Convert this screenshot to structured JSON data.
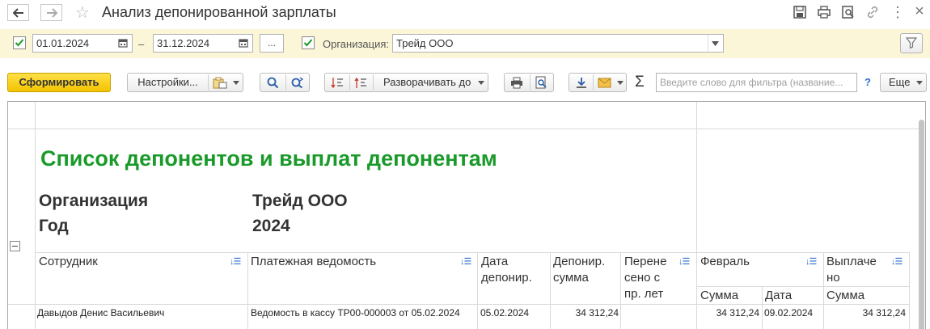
{
  "window": {
    "title": "Анализ депонированной зарплаты",
    "back_icon": "arrow-left-icon",
    "forward_icon": "arrow-right-icon",
    "favorite_icon": "star-icon",
    "title_icons": [
      "save-icon",
      "print-icon",
      "preview-icon",
      "link-icon",
      "more-icon",
      "close-icon"
    ],
    "more_glyph": "⋮",
    "close_glyph": "×"
  },
  "filter": {
    "period_checked": true,
    "date_from": "01.01.2024",
    "date_separator": "–",
    "date_to": "31.12.2024",
    "period_more_label": "...",
    "org_checked": true,
    "org_label": "Организация:",
    "org_value": "Трейд ООО"
  },
  "toolbar": {
    "generate_label": "Сформировать",
    "settings_label": "Настройки...",
    "expand_label": "Разворачивать до",
    "search_placeholder": "Введите слово для фильтра (название...",
    "help_label": "?",
    "more_label": "Еще",
    "sum_label": "Σ"
  },
  "report": {
    "title": "Список депонентов и выплат депонентам",
    "org_label": "Организация",
    "org_value": "Трейд ООО",
    "year_label": "Год",
    "year_value": "2024",
    "columns": {
      "employee": "Сотрудник",
      "statement": "Платежная ведомость",
      "dep_date": "Дата депонир.",
      "dep_sum": "Депонир. сумма",
      "carried": "Перене сено с пр. лет",
      "month": "Февраль",
      "paid": "Выплаче но",
      "month_sum": "Сумма",
      "month_date": "Дата",
      "paid_sum": "Сумма"
    },
    "rows": [
      {
        "employee": "Давыдов Денис Васильевич",
        "statement": "Ведомость в кассу ТР00-000003 от 05.02.2024",
        "dep_date": "05.02.2024",
        "dep_sum": "34 312,24",
        "carried": "",
        "month_sum": "34 312,24",
        "month_date": "09.02.2024",
        "paid_sum": "34 312,24"
      }
    ]
  },
  "colors": {
    "accent_yellow": "#f3c300",
    "title_green": "#1a9a2a",
    "filter_bg": "#fbf6d8",
    "check_green": "#1a9a2a"
  }
}
